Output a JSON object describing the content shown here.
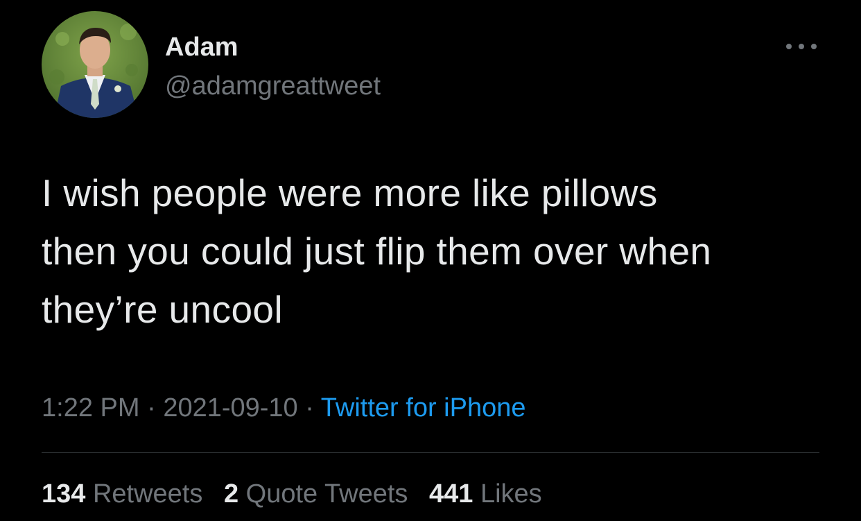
{
  "author": {
    "display_name": "Adam",
    "handle": "@adamgreattweet",
    "avatar": "profile-photo"
  },
  "more_icon": "more-horizontal-icon",
  "tweet": {
    "lines": [
      "I wish people were more like pillows",
      "then you could just flip them over when",
      "they’re uncool"
    ]
  },
  "meta": {
    "time": "1:22 PM",
    "separator": "·",
    "date": "2021-09-10",
    "source": "Twitter for iPhone"
  },
  "stats": {
    "retweets_count": "134",
    "retweets_label": "Retweets",
    "quotes_count": "2",
    "quotes_label": "Quote Tweets",
    "likes_count": "441",
    "likes_label": "Likes"
  },
  "colors": {
    "background": "#000000",
    "primary_text": "#e7e9ea",
    "secondary_text": "#71767b",
    "link": "#1d9bf0",
    "divider": "#2f3336"
  }
}
